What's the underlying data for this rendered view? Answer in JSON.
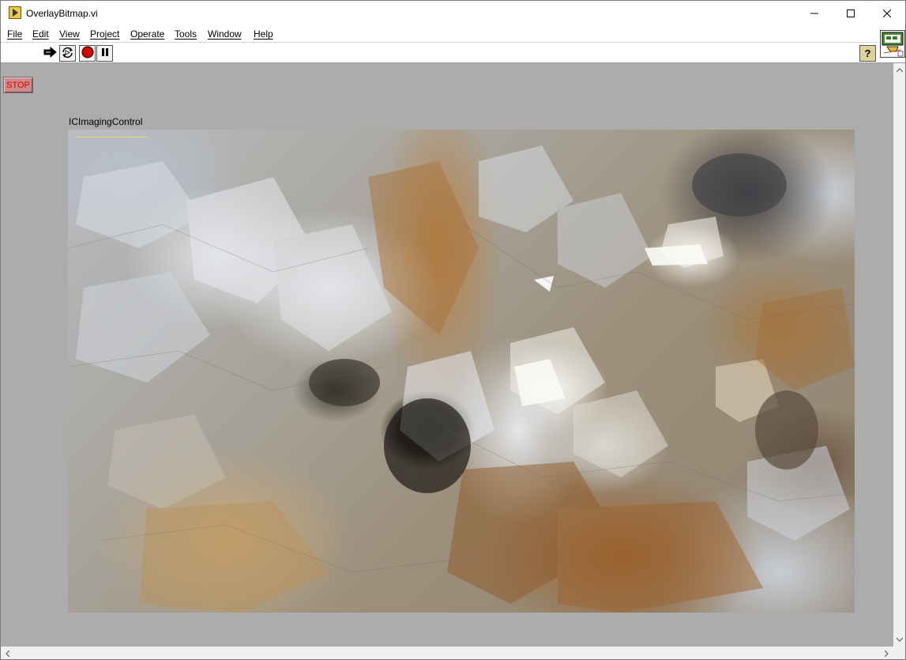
{
  "window": {
    "title": "OverlayBitmap.vi"
  },
  "menu": {
    "items": [
      {
        "label": "File"
      },
      {
        "label": "Edit"
      },
      {
        "label": "View"
      },
      {
        "label": "Project"
      },
      {
        "label": "Operate"
      },
      {
        "label": "Tools"
      },
      {
        "label": "Window"
      },
      {
        "label": "Help"
      }
    ]
  },
  "toolbar": {
    "buttons": [
      {
        "name": "run-arrow-icon"
      },
      {
        "name": "run-continuously-icon"
      },
      {
        "name": "abort-icon"
      },
      {
        "name": "pause-icon"
      }
    ],
    "help_label": "?"
  },
  "panel": {
    "stop_label": "STOP",
    "control_label": "ICImagingControl",
    "background_color": "#acacac",
    "stop_color": "#cc8a8a",
    "overlay_line_color": "#e8e060"
  }
}
